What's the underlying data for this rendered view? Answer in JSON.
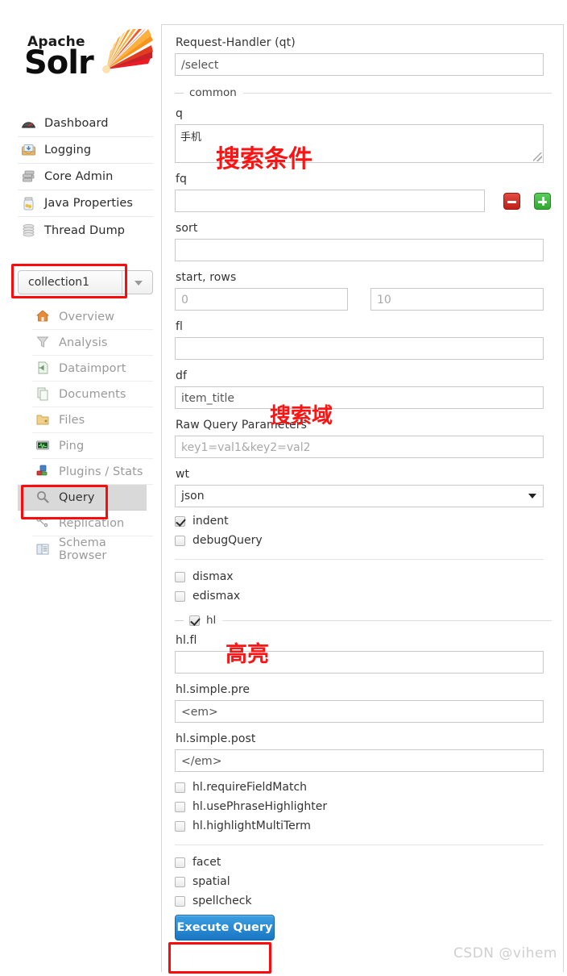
{
  "brand": {
    "apache": "Apache",
    "solr": "Solr",
    "logo_icon": "solr-sun-logo"
  },
  "sidebar": {
    "main_items": [
      {
        "label": "Dashboard",
        "icon": "dashboard-gauge-icon"
      },
      {
        "label": "Logging",
        "icon": "logging-tray-icon"
      },
      {
        "label": "Core Admin",
        "icon": "core-admin-database-icon"
      },
      {
        "label": "Java Properties",
        "icon": "java-properties-jar-icon"
      },
      {
        "label": "Thread Dump",
        "icon": "thread-dump-stack-icon"
      }
    ],
    "core_selector": {
      "value": "collection1",
      "icon": "chevron-down-icon"
    },
    "core_items": [
      {
        "label": "Overview",
        "icon": "overview-home-icon",
        "active": false
      },
      {
        "label": "Analysis",
        "icon": "analysis-funnel-icon",
        "active": false
      },
      {
        "label": "Dataimport",
        "icon": "dataimport-icon",
        "active": false
      },
      {
        "label": "Documents",
        "icon": "documents-icon",
        "active": false
      },
      {
        "label": "Files",
        "icon": "files-folder-icon",
        "active": false
      },
      {
        "label": "Ping",
        "icon": "ping-monitor-icon",
        "active": false
      },
      {
        "label": "Plugins / Stats",
        "icon": "plugins-stats-icon",
        "active": false
      },
      {
        "label": "Query",
        "icon": "query-magnifier-icon",
        "active": true
      },
      {
        "label": "Replication",
        "icon": "replication-icon",
        "active": false
      },
      {
        "label": "Schema Browser",
        "icon": "schema-browser-icon",
        "active": false
      }
    ]
  },
  "query_form": {
    "request_handler": {
      "label": "Request-Handler (qt)",
      "value": "/select"
    },
    "common_legend": "common",
    "q": {
      "label": "q",
      "value": "手机"
    },
    "fq": {
      "label": "fq",
      "value": "",
      "remove_icon": "minus-icon",
      "add_icon": "plus-icon"
    },
    "sort": {
      "label": "sort",
      "value": ""
    },
    "start_rows": {
      "label": "start, rows",
      "start": "0",
      "rows": "10"
    },
    "fl": {
      "label": "fl",
      "value": ""
    },
    "df": {
      "label": "df",
      "value": "item_title"
    },
    "raw_query_parameters": {
      "label": "Raw Query Parameters",
      "placeholder": "key1=val1&key2=val2"
    },
    "wt": {
      "label": "wt",
      "value": "json",
      "icon": "chevron-down-icon"
    },
    "toggles_primary": [
      {
        "label": "indent",
        "checked": true
      },
      {
        "label": "debugQuery",
        "checked": false
      }
    ],
    "toggles_parsers": [
      {
        "label": "dismax",
        "checked": false
      },
      {
        "label": "edismax",
        "checked": false,
        "bold_prefix": "e"
      }
    ],
    "hl_legend": {
      "label": "hl",
      "checked": true
    },
    "hl_fl": {
      "label": "hl.fl",
      "value": ""
    },
    "hl_simple_pre": {
      "label": "hl.simple.pre",
      "value": "<em>"
    },
    "hl_simple_post": {
      "label": "hl.simple.post",
      "value": "</em>"
    },
    "hl_toggles": [
      {
        "label": "hl.requireFieldMatch",
        "checked": false
      },
      {
        "label": "hl.usePhraseHighlighter",
        "checked": false
      },
      {
        "label": "hl.highlightMultiTerm",
        "checked": false
      }
    ],
    "toggles_extra": [
      {
        "label": "facet",
        "checked": false
      },
      {
        "label": "spatial",
        "checked": false
      },
      {
        "label": "spellcheck",
        "checked": false
      }
    ],
    "execute_button": "Execute Query"
  },
  "annotations": {
    "search_condition": "搜索条件",
    "search_field": "搜索域",
    "highlight": "高亮",
    "color": "#fb1414"
  },
  "watermark": "CSDN @vihem"
}
